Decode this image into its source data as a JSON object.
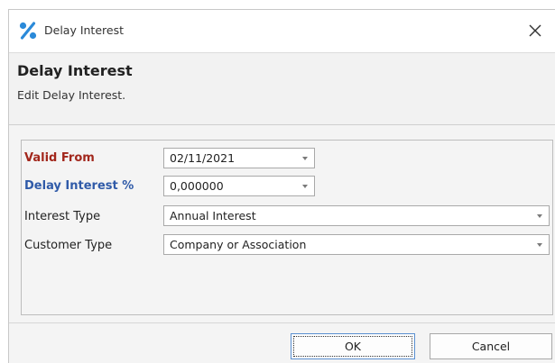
{
  "window": {
    "title": "Delay Interest",
    "title_icon": "percent-icon",
    "close_icon": "close-icon"
  },
  "header": {
    "title": "Delay Interest",
    "subtitle": "Edit Delay Interest."
  },
  "form": {
    "valid_from": {
      "label": "Valid From",
      "value": "02/11/2021",
      "label_color": "#a2271c"
    },
    "delay_interest": {
      "label": "Delay Interest %",
      "value": "0,000000",
      "label_color": "#2f5aa8"
    },
    "interest_type": {
      "label": "Interest Type",
      "value": "Annual Interest"
    },
    "customer_type": {
      "label": "Customer Type",
      "value": "Company or Association"
    }
  },
  "buttons": {
    "ok": "OK",
    "cancel": "Cancel"
  }
}
